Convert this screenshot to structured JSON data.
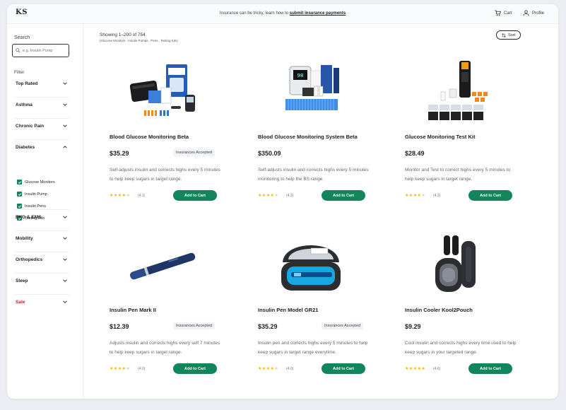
{
  "header": {
    "logo": "KS",
    "banner_text": "Insurance can be tricky, learn how to ",
    "banner_link": "submit insurance payments",
    "cart_label": "Cart",
    "profile_label": "Profile"
  },
  "sidebar": {
    "search_label": "Search",
    "search_placeholder": "e.g. Insulin Pump",
    "filter_label": "Filter",
    "categories": [
      {
        "label": "Top Rated"
      },
      {
        "label": "Asthma"
      },
      {
        "label": "Chronic Pain"
      },
      {
        "label": "Diabetes"
      },
      {
        "label": "EKG & EMS"
      },
      {
        "label": "Mobility"
      },
      {
        "label": "Orthopedics"
      },
      {
        "label": "Sleep"
      },
      {
        "label": "Sale"
      }
    ],
    "diabetes_subitems": [
      {
        "label": "Glucose Monitors"
      },
      {
        "label": "Insulin Pump"
      },
      {
        "label": "Insulin Pens"
      },
      {
        "label": "Testing Kits"
      }
    ]
  },
  "results": {
    "showing": "Showing 1–200 of 754",
    "filters_summary": "(Glucose Monitors , Insulin Pumps , Pens , Testing Kits)",
    "sort_label": "Sort"
  },
  "products": [
    {
      "title": "Blood Glucose Monitoring  Beta",
      "price": "$35.29",
      "badge": "Insurances Accepted",
      "desc": "Self-adjusts insulin and corrects highs every 5 minutes to help keep sugars in target range.",
      "rating": 4,
      "rating_count": "(4.1)",
      "button": "Add to Cart"
    },
    {
      "title": "Blood Glucose Monitoring System Beta",
      "price": "$350.09",
      "badge": "",
      "desc": "Self-adjusts insulin and corrects highs every 5 minutes monitoring to help the BS range.",
      "rating": 4,
      "rating_count": "(4.2)",
      "button": "Add to Cart"
    },
    {
      "title": "Glucose Monitoring Test Kit",
      "price": "$28.49",
      "badge": "",
      "desc": "Monitor and Test to correct highs every 5 minutes to help keep sugars in target range.",
      "rating": 4,
      "rating_count": "(4.2)",
      "button": "Add to Cart"
    },
    {
      "title": "Insulin Pen Mark II",
      "price": "$12.39",
      "badge": "Insurances Accepted",
      "desc": "Adjusts insulin and corrects highs every self 7 minutes to help keep sugars in target range.",
      "rating": 4,
      "rating_count": "(4.0)",
      "button": "Add to Cart"
    },
    {
      "title": "Insulin Pen Model GR21",
      "price": "$35.29",
      "badge": "Insurances Accepted",
      "desc": "Insulin pen and corrects highs every 5 minutes to help keep sugars in target range everytime.",
      "rating": 4,
      "rating_count": "(4.0)",
      "button": "Add to Cart"
    },
    {
      "title": "Insulin Cooler Kool2Pouch",
      "price": "$9.29",
      "badge": "",
      "desc": "Cool insulin and corrects highs every time used to help keep sugars in your targeted range.",
      "rating": 5,
      "rating_count": "(4.6)",
      "button": "Add to Cart"
    }
  ],
  "colors": {
    "accent": "#13855c",
    "sale": "#c0262d",
    "star": "#f5b400"
  }
}
